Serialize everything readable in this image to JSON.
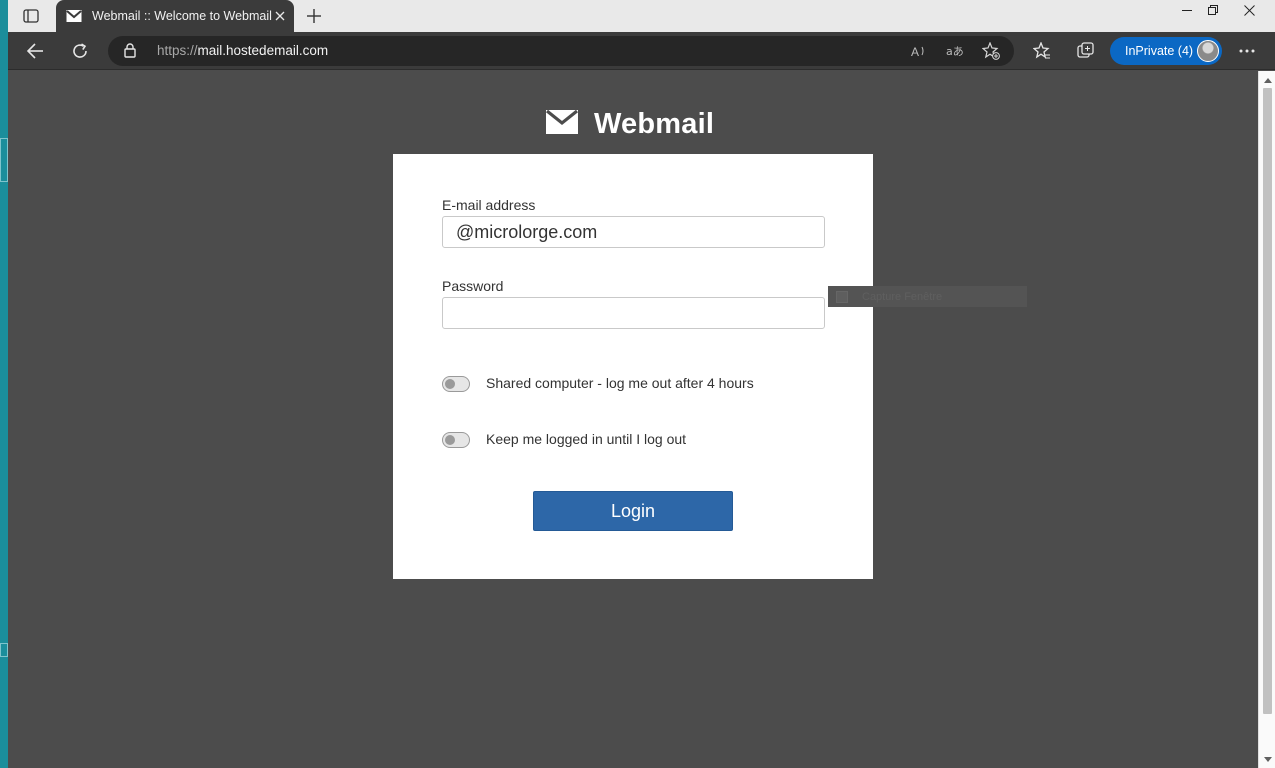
{
  "browser": {
    "tab_title": "Webmail :: Welcome to Webmail",
    "url_scheme": "https://",
    "url_host": "mail.hostedemail.com",
    "profile_label": "InPrivate (4)",
    "accent_color": "#0b68c4"
  },
  "page": {
    "brand_name": "Webmail",
    "email_label": "E-mail address",
    "email_value": "@microlorge.com",
    "password_label": "Password",
    "password_value": "",
    "shared_computer_label": "Shared computer - log me out after 4 hours",
    "keep_logged_in_label": "Keep me logged in until I log out",
    "login_button": "Login",
    "login_button_color": "#2d67a8",
    "overlay_text": "Capture Fenêtre"
  },
  "icons": [
    "tab-actions-icon",
    "mail-icon",
    "close-icon",
    "plus-icon",
    "minimize-icon",
    "restore-icon",
    "back-icon",
    "refresh-icon",
    "lock-icon",
    "read-aloud-icon",
    "translate-icon",
    "add-favorite-icon",
    "favorites-icon",
    "collections-icon",
    "more-icon",
    "envelope-logo-icon"
  ]
}
